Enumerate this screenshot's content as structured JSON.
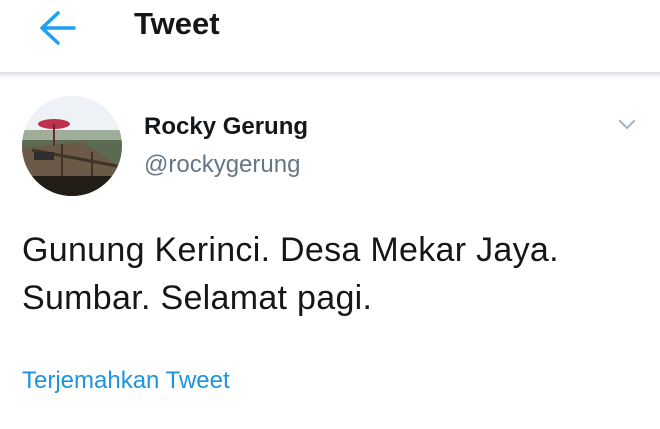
{
  "header": {
    "back_icon": "back-arrow-icon",
    "title": "Tweet"
  },
  "tweet": {
    "author": {
      "name": "Rocky Gerung",
      "handle": "@rockygerung",
      "avatar_icon": "avatar-photo"
    },
    "menu_icon": "chevron-down-icon",
    "text": "Gunung Kerinci. Desa Mekar Jaya. Sumbar. Selamat pagi.",
    "translate_label": "Terjemahkan Tweet"
  },
  "colors": {
    "accent": "#1da1f2",
    "link": "#1b95e0",
    "secondary_text": "#657786",
    "primary_text": "#14171a"
  }
}
